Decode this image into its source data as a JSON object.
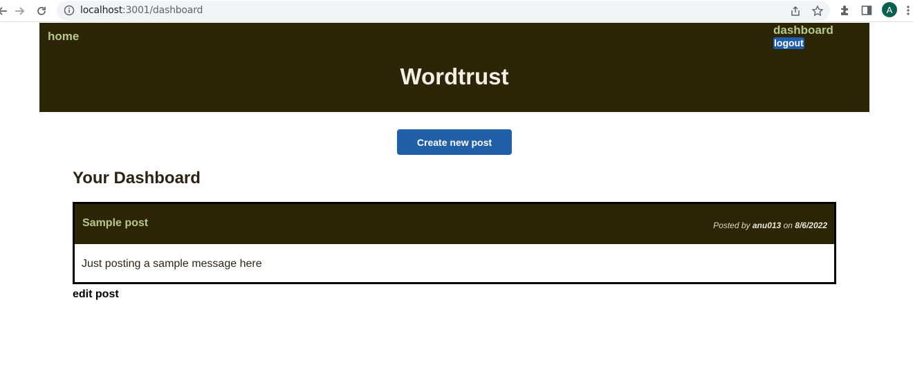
{
  "browser": {
    "url_host": "localhost",
    "url_path": ":3001/dashboard",
    "avatar_letter": "A",
    "icons": [
      "back-icon",
      "forward-icon",
      "reload-icon",
      "info-icon",
      "share-icon",
      "star-icon",
      "extensions-icon",
      "side-panel-icon",
      "avatar",
      "menu-icon"
    ]
  },
  "header": {
    "home_label": "home",
    "dashboard_label": "dashboard",
    "logout_label": "logout",
    "site_title": "Wordtrust"
  },
  "main": {
    "create_button_label": "Create new post",
    "dashboard_title": "Your Dashboard",
    "posts": [
      {
        "title": "Sample post",
        "posted_by_prefix": "Posted by",
        "author": "anu013",
        "on_word": "on",
        "date": "8/6/2022",
        "body": "Just posting a sample message here",
        "edit_label": "edit post"
      }
    ]
  },
  "colors": {
    "header_bg": "#2d2507",
    "accent_green": "#b6c98a",
    "button_blue": "#2160a6"
  }
}
